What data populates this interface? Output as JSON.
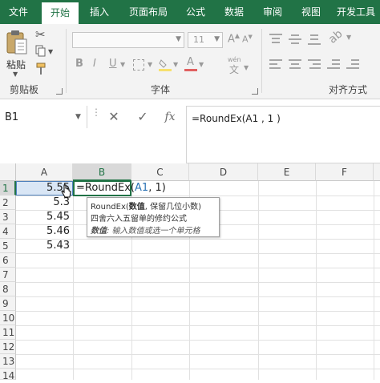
{
  "ribbon_tabs": [
    "文件",
    "开始",
    "插入",
    "页面布局",
    "公式",
    "数据",
    "审阅",
    "视图",
    "开发工具"
  ],
  "clipboard": {
    "paste_label": "粘贴",
    "group_label": "剪贴板"
  },
  "font": {
    "size_value": "11",
    "group_label": "字体",
    "grow_glyph": "A",
    "shrink_glyph": "A",
    "bold": "B",
    "italic": "I",
    "underline": "U",
    "phonetic": "wén"
  },
  "alignment": {
    "group_label": "对齐方式"
  },
  "formula_bar": {
    "name_box": "B1",
    "cancel_glyph": "✕",
    "enter_glyph": "✓",
    "fx_glyph": "fx",
    "formula": "=RoundEx(A1 , 1 )"
  },
  "grid": {
    "columns": [
      "A",
      "B",
      "C",
      "D",
      "E",
      "F"
    ],
    "rows": [
      "1",
      "2",
      "3",
      "4",
      "5",
      "6",
      "7",
      "8",
      "9",
      "10",
      "11",
      "12",
      "13",
      "14"
    ],
    "a_values": [
      "5.55",
      "5.3",
      "5.45",
      "5.46",
      "5.43"
    ],
    "b1_editing": {
      "prefix": "=RoundEx(",
      "ref": "A1",
      "suffix": ",  1)"
    }
  },
  "tooltip": {
    "line1_func": "RoundEx(",
    "line1_arg": "数值",
    "line1_rest": ", 保留几位小数)",
    "line2": "四舍六入五留单的修约公式",
    "line3_arg": "数值",
    "line3_desc": ": 输入数值或选一个单元格"
  },
  "colors": {
    "excel_green": "#217346",
    "ref_blue": "#2e74b5"
  }
}
